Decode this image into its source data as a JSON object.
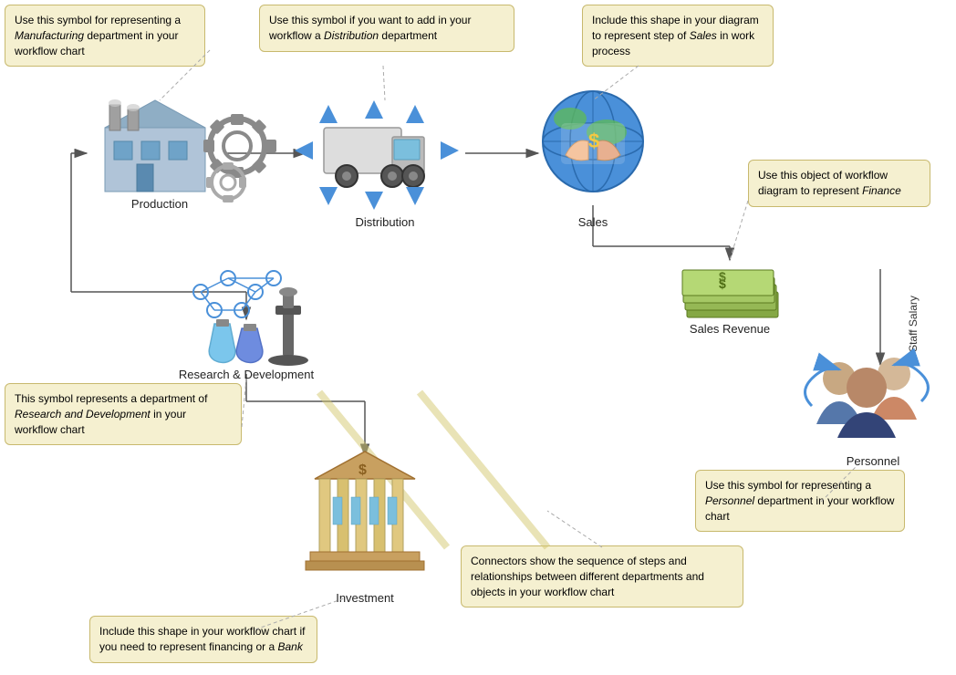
{
  "tooltips": {
    "manufacturing": {
      "text": "Use this symbol for representing a Manufacturing department in your workflow chart",
      "italic": "Manufacturing"
    },
    "distribution": {
      "text": "Use this symbol if you want to add in your workflow a Distribution department",
      "italic": "Distribution"
    },
    "sales": {
      "text": "Include this shape in your diagram to represent step of Sales in work process",
      "italic": "Sales"
    },
    "finance": {
      "text": "Use this object of workflow diagram to represent Finance",
      "italic": "Finance"
    },
    "rd": {
      "text": "This symbol represents a department of Research and Development in your workflow chart",
      "italic": "Research and Development"
    },
    "personnel": {
      "text": "Use this symbol for representing a Personnel department in your workflow chart",
      "italic": "Personnel"
    },
    "bank": {
      "text": "Include this shape in your workflow chart if you need to represent financing or a Bank",
      "italic": "Bank"
    },
    "connectors": {
      "text": "Connectors show the sequence of steps and relationships between different departments and objects in your workflow chart"
    }
  },
  "nodes": {
    "production": {
      "label": "Production"
    },
    "distribution": {
      "label": "Distribution"
    },
    "sales": {
      "label": "Sales"
    },
    "sales_revenue": {
      "label": "Sales Revenue"
    },
    "rd": {
      "label": "Research & Development"
    },
    "personnel": {
      "label": "Personnel"
    },
    "investment": {
      "label": "Investment"
    },
    "staff_salary": {
      "label": "Staff Salary"
    }
  }
}
